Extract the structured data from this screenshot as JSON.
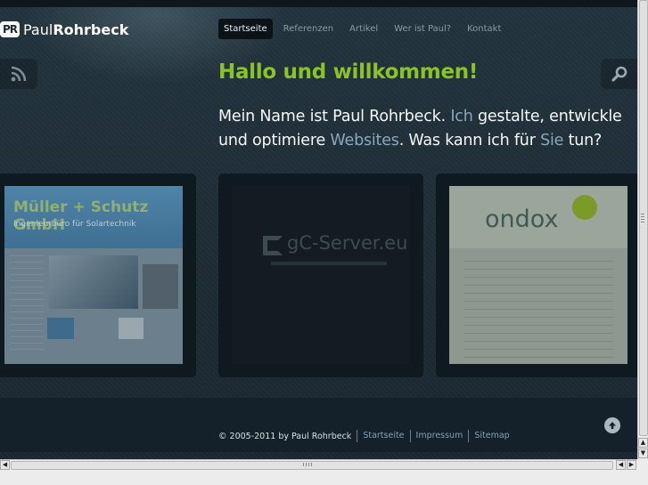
{
  "site": {
    "logo_mark": "PR",
    "logo_first": "Paul",
    "logo_last": "Rohrbeck"
  },
  "nav": {
    "items": [
      {
        "label": "Startseite",
        "active": true
      },
      {
        "label": "Referenzen",
        "active": false
      },
      {
        "label": "Artikel",
        "active": false
      },
      {
        "label": "Wer ist Paul?",
        "active": false
      },
      {
        "label": "Kontakt",
        "active": false
      }
    ]
  },
  "icons": {
    "rss": "rss-icon",
    "search": "search-icon",
    "to_top": "arrow-up-icon"
  },
  "main": {
    "headline": "Hallo und willkommen!",
    "intro": {
      "p1": "Mein Name ist Paul Rohrbeck. ",
      "hl1": "Ich",
      "p2": " gestalte, entwickle und optimiere ",
      "hl2": "Websites",
      "p3": ". Was kann ich für ",
      "hl3": "Sie",
      "p4": " tun?"
    }
  },
  "references": [
    {
      "title": "Müller + Schutz GmbH",
      "subtitle": "Ingenieurbüro für Solartechnik"
    },
    {
      "title": "gC-Server.eu"
    },
    {
      "title": "ondox"
    }
  ],
  "footer": {
    "copyright": "© 2005-2011 by Paul Rohrbeck",
    "links": [
      "Startseite",
      "Impressum",
      "Sitemap"
    ]
  },
  "colors": {
    "background": "#1b2a33",
    "headline": "#8bc327",
    "highlight": "#8aa7bc",
    "link": "#7fa3ba"
  }
}
